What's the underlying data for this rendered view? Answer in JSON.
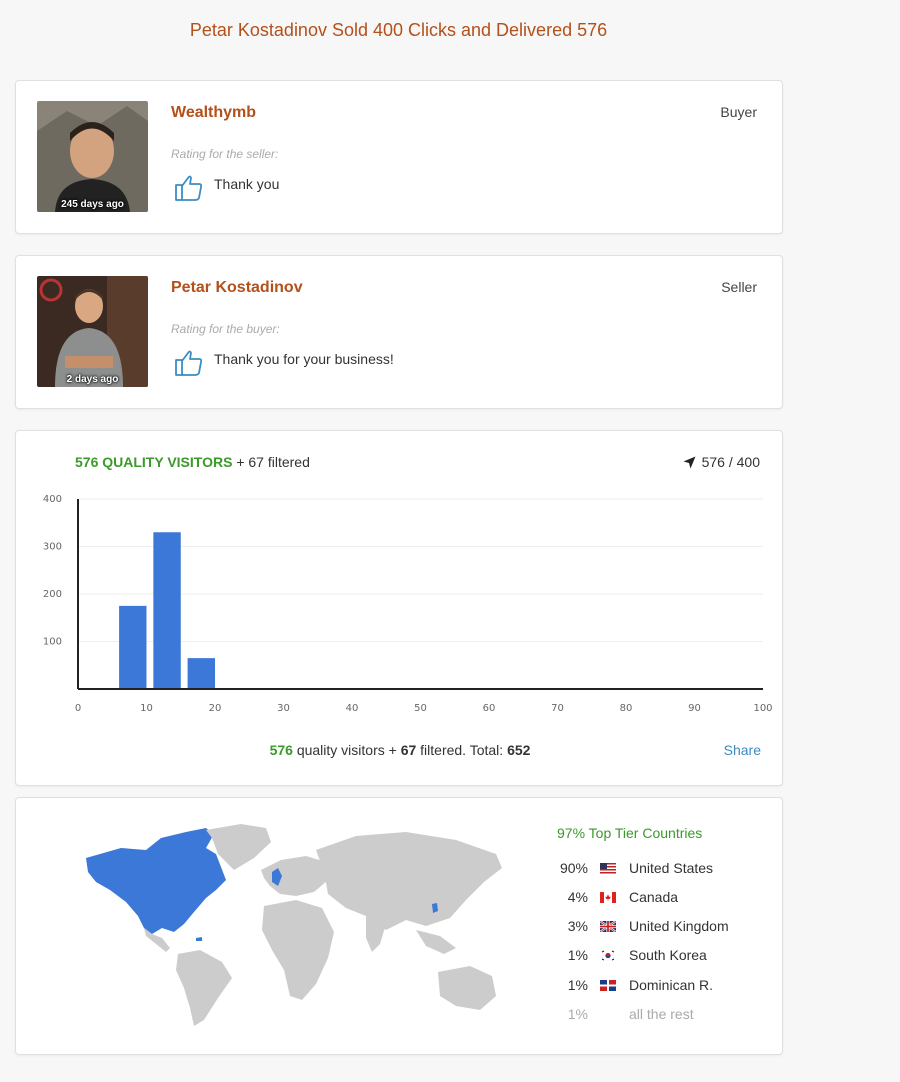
{
  "page": {
    "title": "Petar Kostadinov Sold 400 Clicks and Delivered 576"
  },
  "reviews": [
    {
      "name": "Wealthymb",
      "role": "Buyer",
      "time_ago": "245 days ago",
      "rating_label": "Rating for the seller:",
      "text": "Thank you"
    },
    {
      "name": "Petar Kostadinov",
      "role": "Seller",
      "time_ago": "2 days ago",
      "rating_label": "Rating for the buyer:",
      "text": "Thank you for your business!"
    }
  ],
  "visitors": {
    "quality_count": "576",
    "quality_label": "QUALITY VISITORS",
    "filtered_text": "+ 67 filtered",
    "delivered_ratio": "576 / 400",
    "footer_quality": "576",
    "footer_text_1": "quality visitors +",
    "footer_filtered": "67",
    "footer_text_2": "filtered. Total:",
    "footer_total": "652",
    "share_label": "Share"
  },
  "chart_data": {
    "type": "bar",
    "title": "",
    "xlabel": "",
    "ylabel": "",
    "x": [
      8,
      13,
      18
    ],
    "values": [
      175,
      330,
      65
    ],
    "bar_width": 4,
    "xlim": [
      0,
      100
    ],
    "ylim": [
      0,
      400
    ],
    "xticks": [
      0,
      10,
      20,
      30,
      40,
      50,
      60,
      70,
      80,
      90,
      100
    ],
    "yticks": [
      100,
      200,
      300,
      400
    ],
    "grid": true,
    "bar_color": "#3c78d8"
  },
  "countries": {
    "tier_title": "97% Top Tier Countries",
    "rows": [
      {
        "pct": "90%",
        "flag": "us-flag-icon",
        "name": "United States"
      },
      {
        "pct": "4%",
        "flag": "canada-flag-icon",
        "name": "Canada"
      },
      {
        "pct": "3%",
        "flag": "uk-flag-icon",
        "name": "United Kingdom"
      },
      {
        "pct": "1%",
        "flag": "south-korea-flag-icon",
        "name": "South Korea"
      },
      {
        "pct": "1%",
        "flag": "dominican-flag-icon",
        "name": "Dominican R."
      }
    ],
    "rest": {
      "pct": "1%",
      "name": "all the rest"
    }
  },
  "colors": {
    "accent": "#b4501a",
    "green": "#3a9a2a",
    "bar": "#3c78d8",
    "link": "#3b8cc4",
    "map_highlight": "#3c78d8",
    "map_base": "#cccccc"
  }
}
